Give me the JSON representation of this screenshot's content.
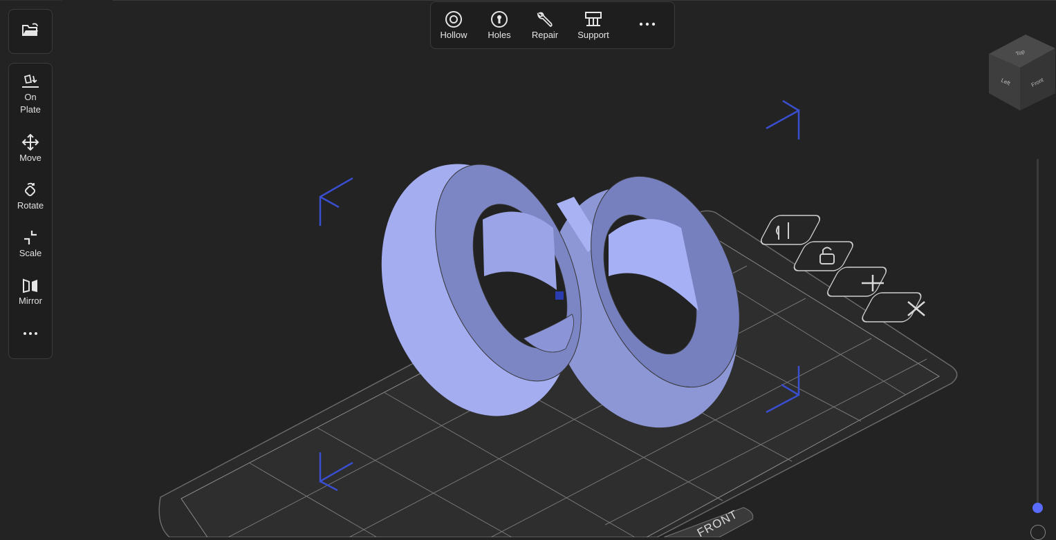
{
  "left_toolbar": {
    "open_icon": "folder-open-icon",
    "tools": [
      {
        "id": "on-plate",
        "label": "On\nPlate",
        "icon": "on-plate-icon"
      },
      {
        "id": "move",
        "label": "Move",
        "icon": "move-icon"
      },
      {
        "id": "rotate",
        "label": "Rotate",
        "icon": "rotate-icon"
      },
      {
        "id": "scale",
        "label": "Scale",
        "icon": "scale-icon"
      },
      {
        "id": "mirror",
        "label": "Mirror",
        "icon": "mirror-icon"
      }
    ],
    "more_icon": "more-icon"
  },
  "top_toolbar": {
    "items": [
      {
        "id": "hollow",
        "label": "Hollow",
        "icon": "hollow-icon"
      },
      {
        "id": "holes",
        "label": "Holes",
        "icon": "holes-icon"
      },
      {
        "id": "repair",
        "label": "Repair",
        "icon": "wrench-icon"
      },
      {
        "id": "support",
        "label": "Support",
        "icon": "support-icon"
      }
    ],
    "more_icon": "more-icon"
  },
  "view_cube": {
    "top": "Top",
    "left": "Left",
    "front": "Front"
  },
  "plate": {
    "front_label": "FRONT"
  },
  "colors": {
    "background": "#232323",
    "model": "#a6b0f2",
    "model_dark": "#7e88bf",
    "gizmo": "#3a4ed0",
    "accent": "#5a6cff"
  }
}
